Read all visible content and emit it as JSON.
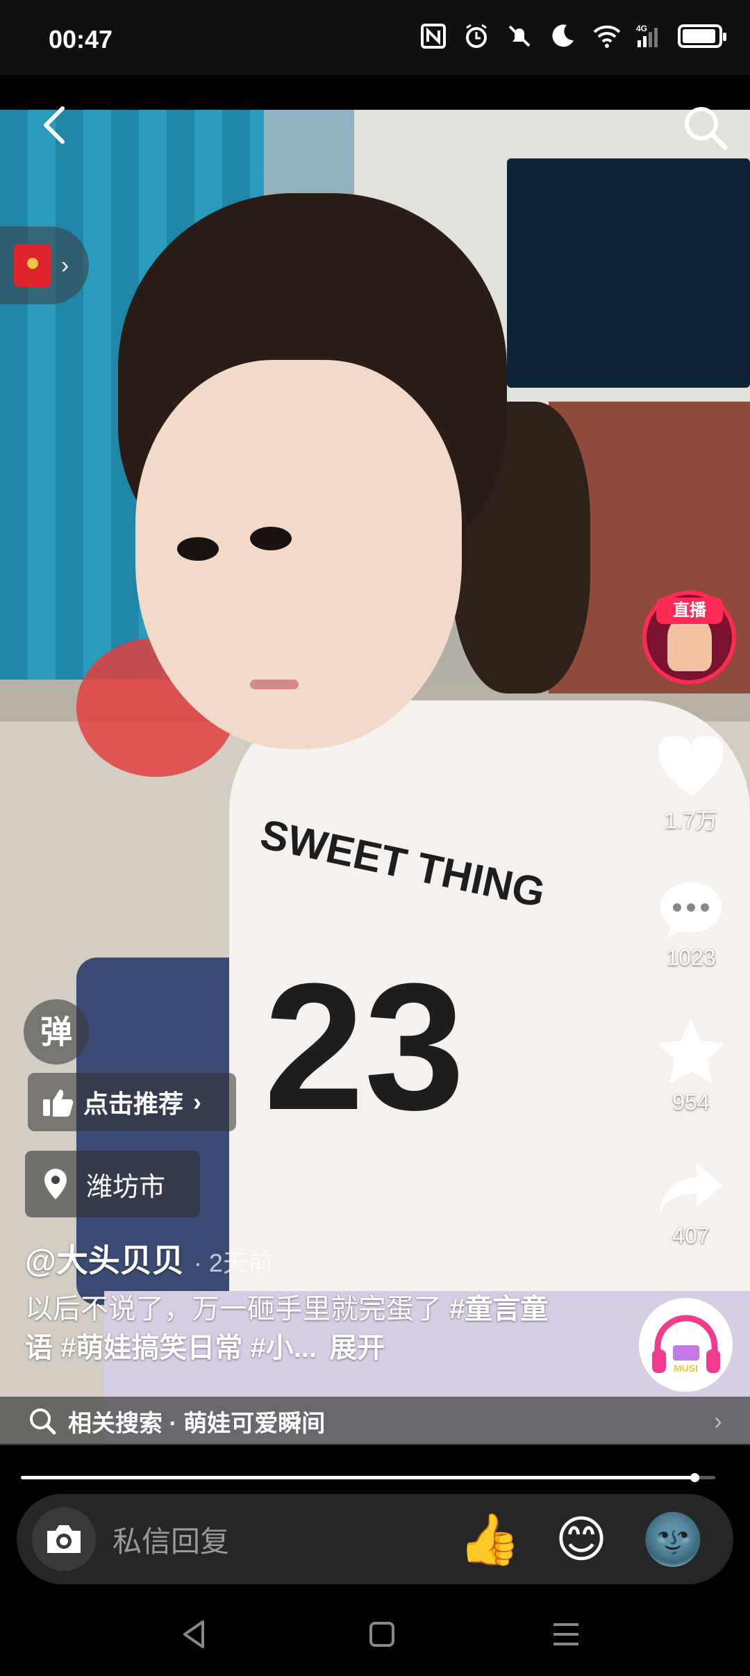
{
  "status_bar": {
    "time": "00:47",
    "icons": [
      "nfc-icon",
      "alarm-icon",
      "mute-icon",
      "moon-icon",
      "wifi-icon",
      "4g-signal-icon",
      "battery-icon"
    ]
  },
  "top": {
    "back_icon": "back-chevron-icon",
    "search_icon": "search-icon"
  },
  "red_packet": {
    "icon": "red-envelope-icon"
  },
  "live": {
    "badge": "直播"
  },
  "actions": {
    "like_count": "1.7万",
    "comment_count": "1023",
    "favorite_count": "954",
    "share_count": "407"
  },
  "music": {
    "label": "MUSI"
  },
  "overlays": {
    "danmu_label": "弹",
    "recommend_label": "点击推荐",
    "location_label": "潍坊市"
  },
  "post": {
    "author": "@大头贝贝",
    "time": "· 2天前",
    "caption_plain": "以后不说了，万一砸手里就完蛋了 ",
    "caption_tags": "#童言童语 #萌娃搞笑日常 #小...",
    "expand": "展开"
  },
  "shirt": {
    "text": "SWEET THING",
    "number": "23"
  },
  "related_search": {
    "label": "相关搜索 · 萌娃可爱瞬间"
  },
  "progress": {
    "fraction": 0.97
  },
  "reply": {
    "placeholder": "私信回复",
    "emojis": [
      "👍",
      "😊",
      "🌚"
    ]
  },
  "colors": {
    "accent": "#fe2c55"
  }
}
